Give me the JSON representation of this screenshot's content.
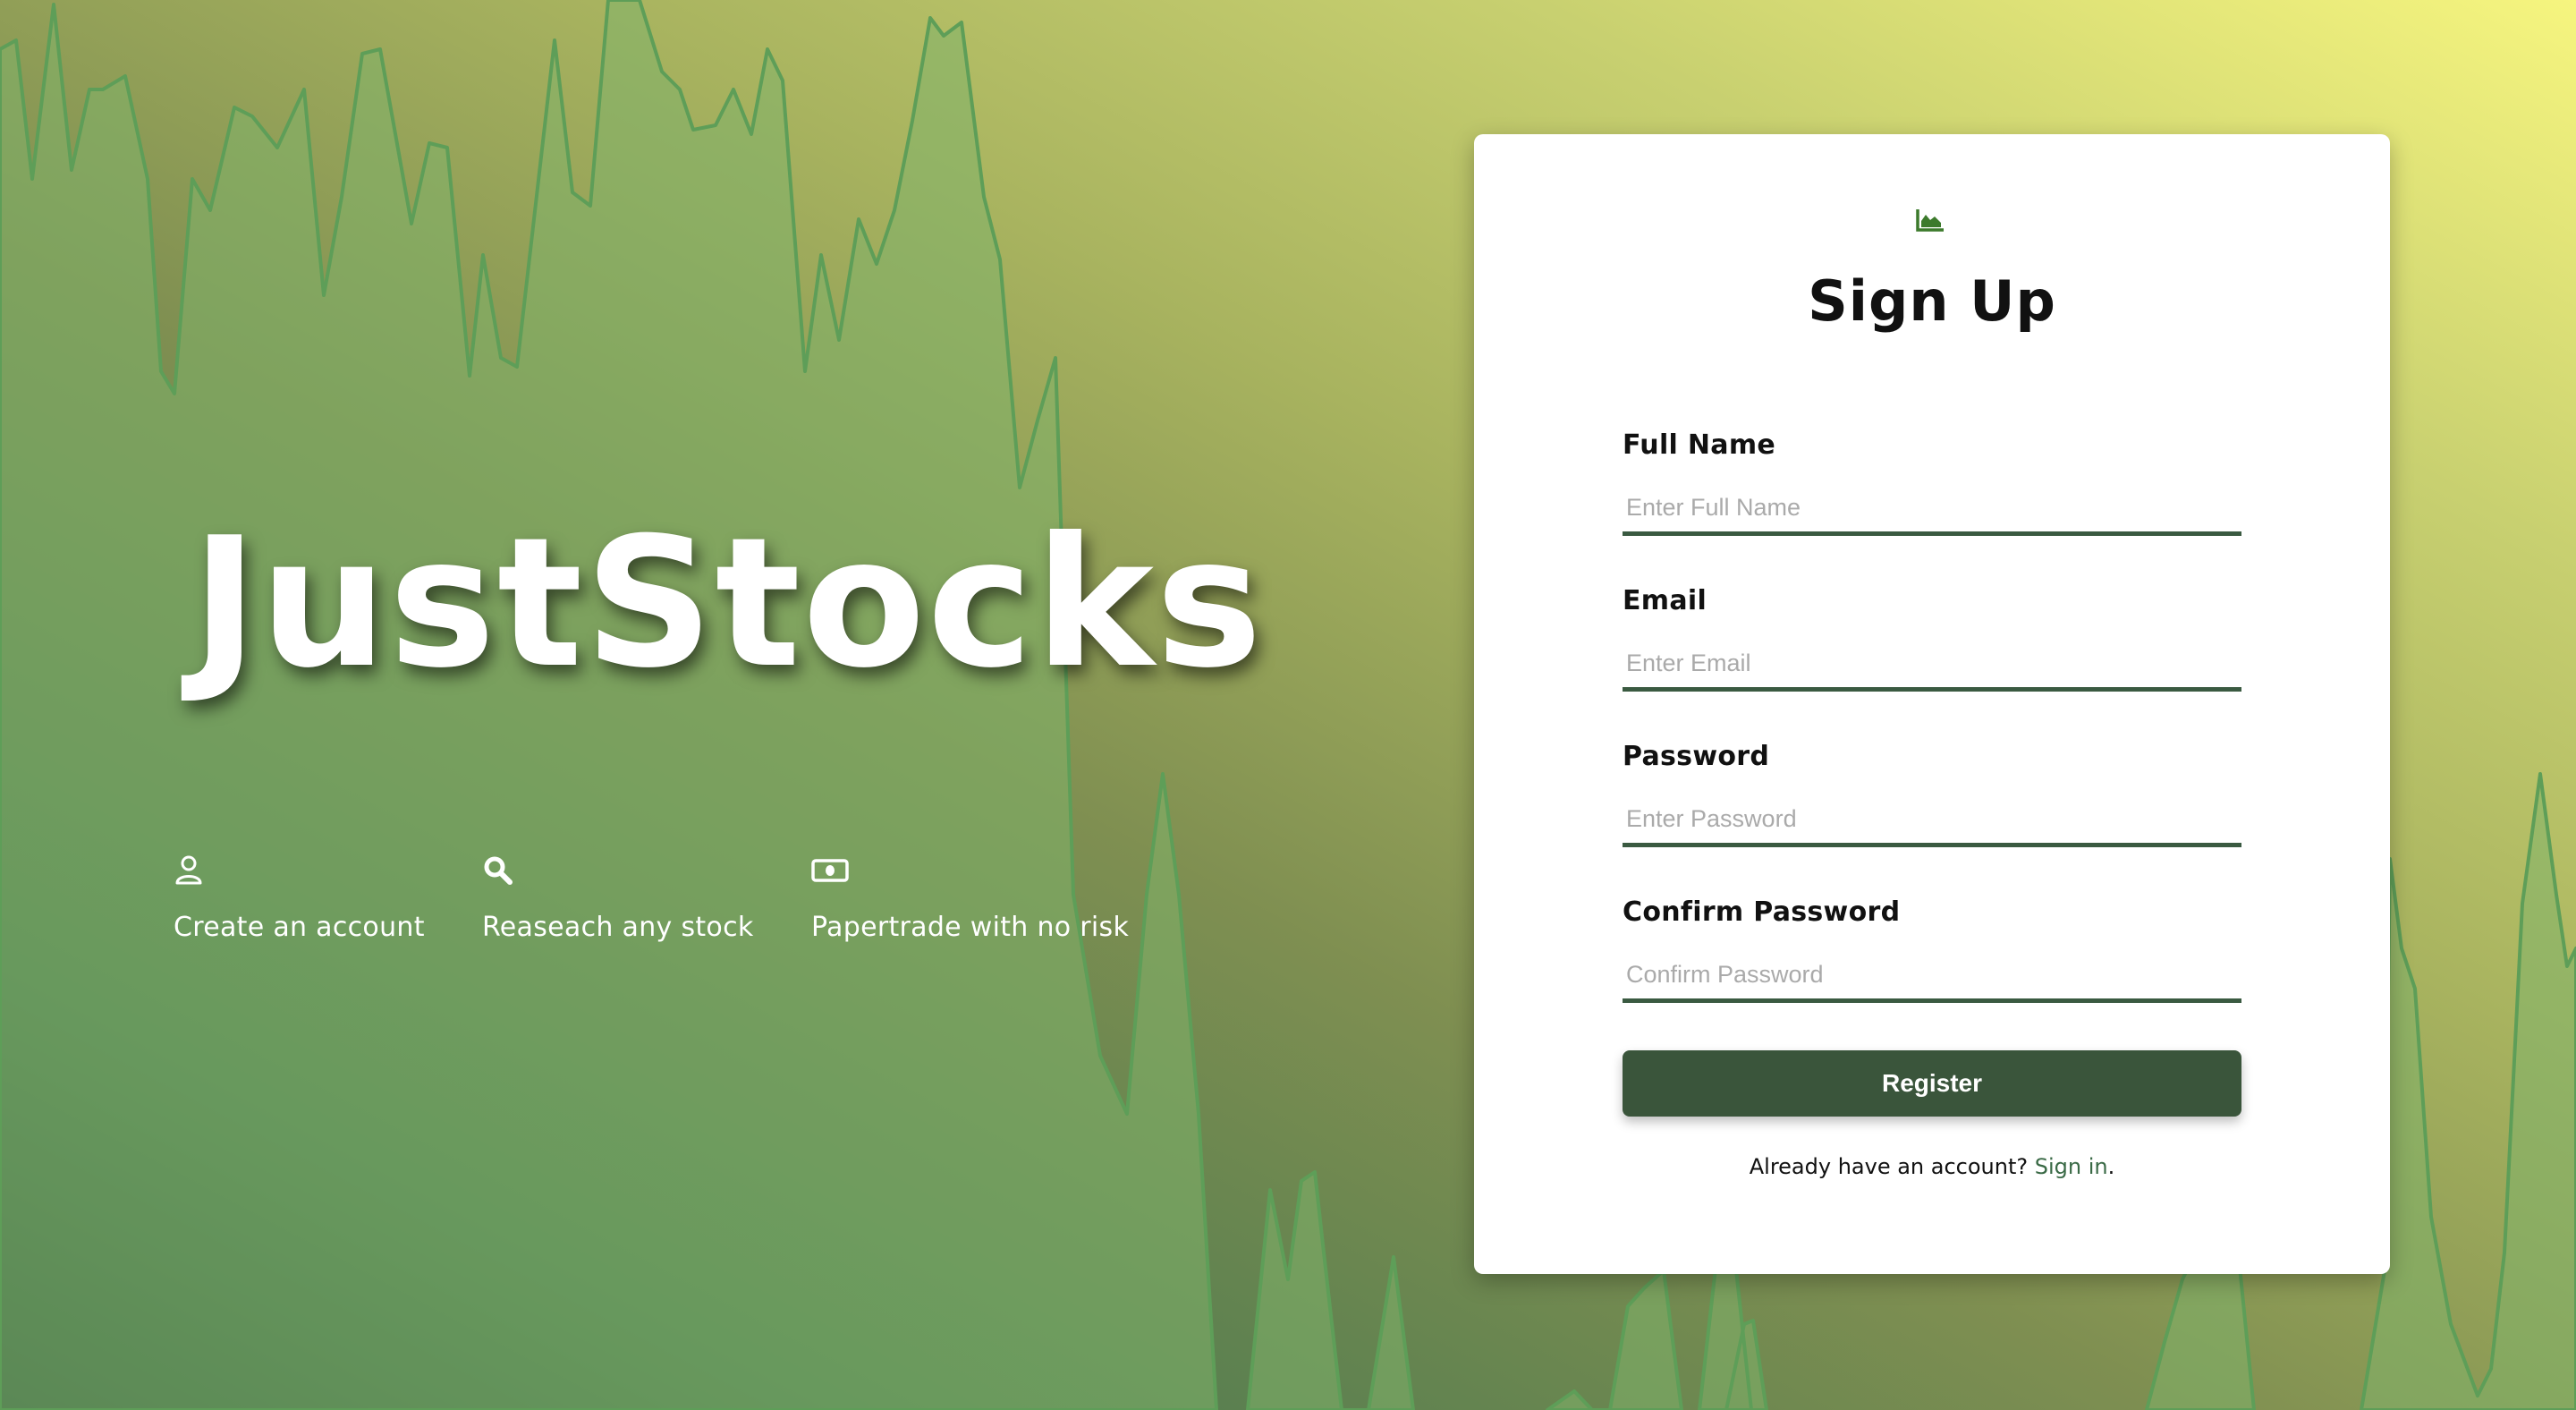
{
  "hero": {
    "brand": "JustStocks",
    "features": [
      {
        "icon": "user-icon",
        "label": "Create an account"
      },
      {
        "icon": "search-icon",
        "label": "Reaseach any stock"
      },
      {
        "icon": "money-bill-icon",
        "label": "Papertrade with no risk"
      }
    ]
  },
  "form": {
    "logo_icon": "chart-area-icon",
    "title": "Sign Up",
    "fields": [
      {
        "label": "Full Name",
        "placeholder": "Enter Full Name",
        "value": ""
      },
      {
        "label": "Email",
        "placeholder": "Enter Email",
        "value": ""
      },
      {
        "label": "Password",
        "placeholder": "Enter Password",
        "value": ""
      },
      {
        "label": "Confirm Password",
        "placeholder": "Confirm Password",
        "value": ""
      }
    ],
    "register_label": "Register",
    "signin_prefix": "Already have an account?",
    "signin_link": "Sign in",
    "signin_suffix": "."
  },
  "colors": {
    "accent": "#3a553b",
    "link": "#3a6a46",
    "chart_fill": "#7fb36a",
    "chart_line": "#5e9e58"
  }
}
